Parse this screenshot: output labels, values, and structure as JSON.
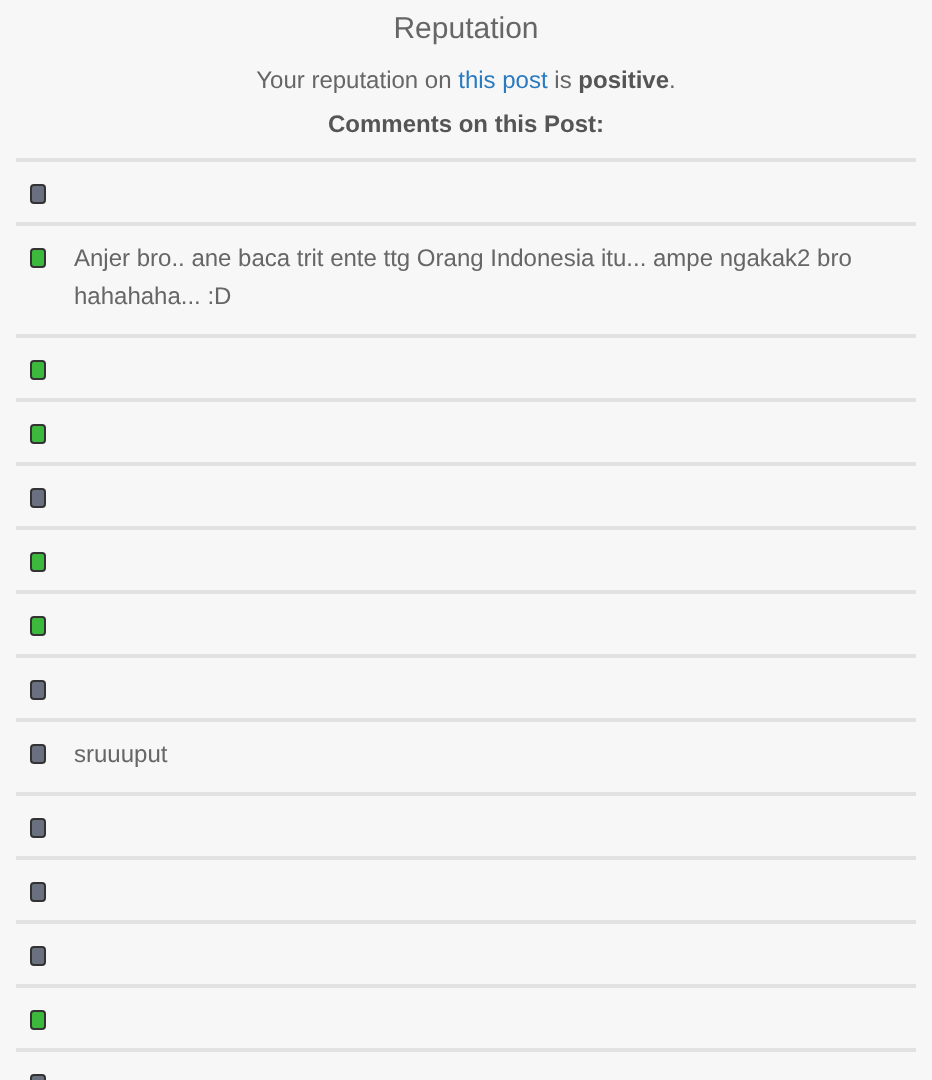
{
  "title": "Reputation",
  "summary": {
    "before": "Your reputation on",
    "link": "this post",
    "middle": "is",
    "value": "positive",
    "after": "."
  },
  "comments_heading": "Comments on this Post:",
  "comments": [
    {
      "color": "#6b7080"
    },
    {
      "color": "#3cb83c",
      "text": "Anjer bro.. ane baca trit ente ttg Orang Indonesia itu... ampe ngakak2 bro hahahaha... :D"
    },
    {
      "color": "#3cb83c"
    },
    {
      "color": "#3cb83c"
    },
    {
      "color": "#6b7080"
    },
    {
      "color": "#3cb83c"
    },
    {
      "color": "#3cb83c"
    },
    {
      "color": "#6b7080"
    },
    {
      "color": "#6b7080",
      "text": "sruuuput"
    },
    {
      "color": "#6b7080"
    },
    {
      "color": "#6b7080"
    },
    {
      "color": "#6b7080"
    },
    {
      "color": "#3cb83c"
    },
    {
      "color": "#6b7080"
    }
  ]
}
